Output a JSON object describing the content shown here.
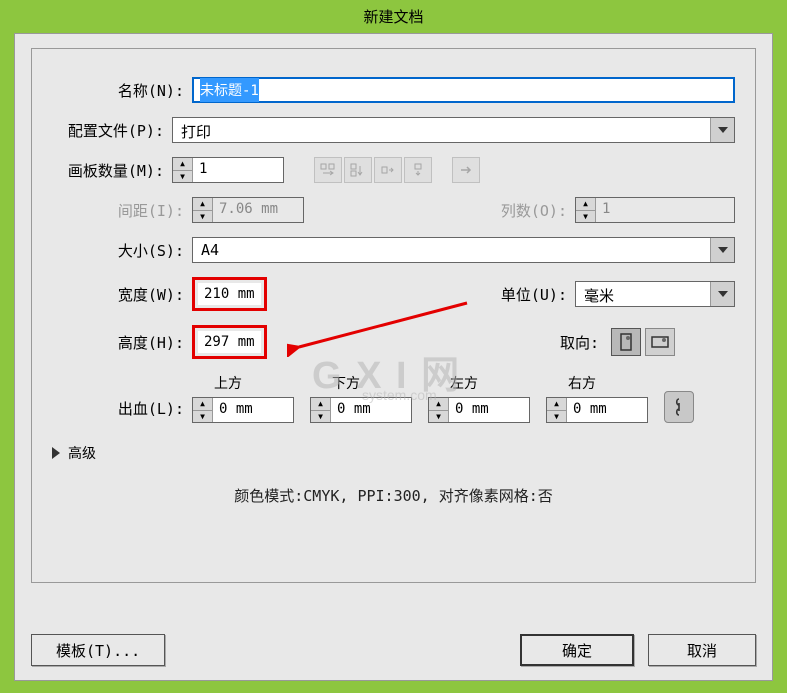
{
  "title": "新建文档",
  "name": {
    "label": "名称(N):",
    "value": "未标题-1"
  },
  "profile": {
    "label": "配置文件(P):",
    "value": "打印"
  },
  "artboards": {
    "label": "画板数量(M):",
    "value": "1"
  },
  "spacing": {
    "label": "间距(I):",
    "value": "7.06 mm"
  },
  "columns": {
    "label": "列数(O):",
    "value": "1"
  },
  "size": {
    "label": "大小(S):",
    "value": "A4"
  },
  "width": {
    "label": "宽度(W):",
    "value": "210 mm"
  },
  "height": {
    "label": "高度(H):",
    "value": "297 mm"
  },
  "units": {
    "label": "单位(U):",
    "value": "毫米"
  },
  "orientation": {
    "label": "取向:"
  },
  "bleed": {
    "label": "出血(L):",
    "top": {
      "label": "上方",
      "value": "0 mm"
    },
    "bottom": {
      "label": "下方",
      "value": "0 mm"
    },
    "left": {
      "label": "左方",
      "value": "0 mm"
    },
    "right": {
      "label": "右方",
      "value": "0 mm"
    }
  },
  "advanced": "高级",
  "info": "颜色模式:CMYK, PPI:300, 对齐像素网格:否",
  "buttons": {
    "template": "模板(T)...",
    "ok": "确定",
    "cancel": "取消"
  },
  "watermark": {
    "main": "G X I 网",
    "sub": "system.com"
  }
}
